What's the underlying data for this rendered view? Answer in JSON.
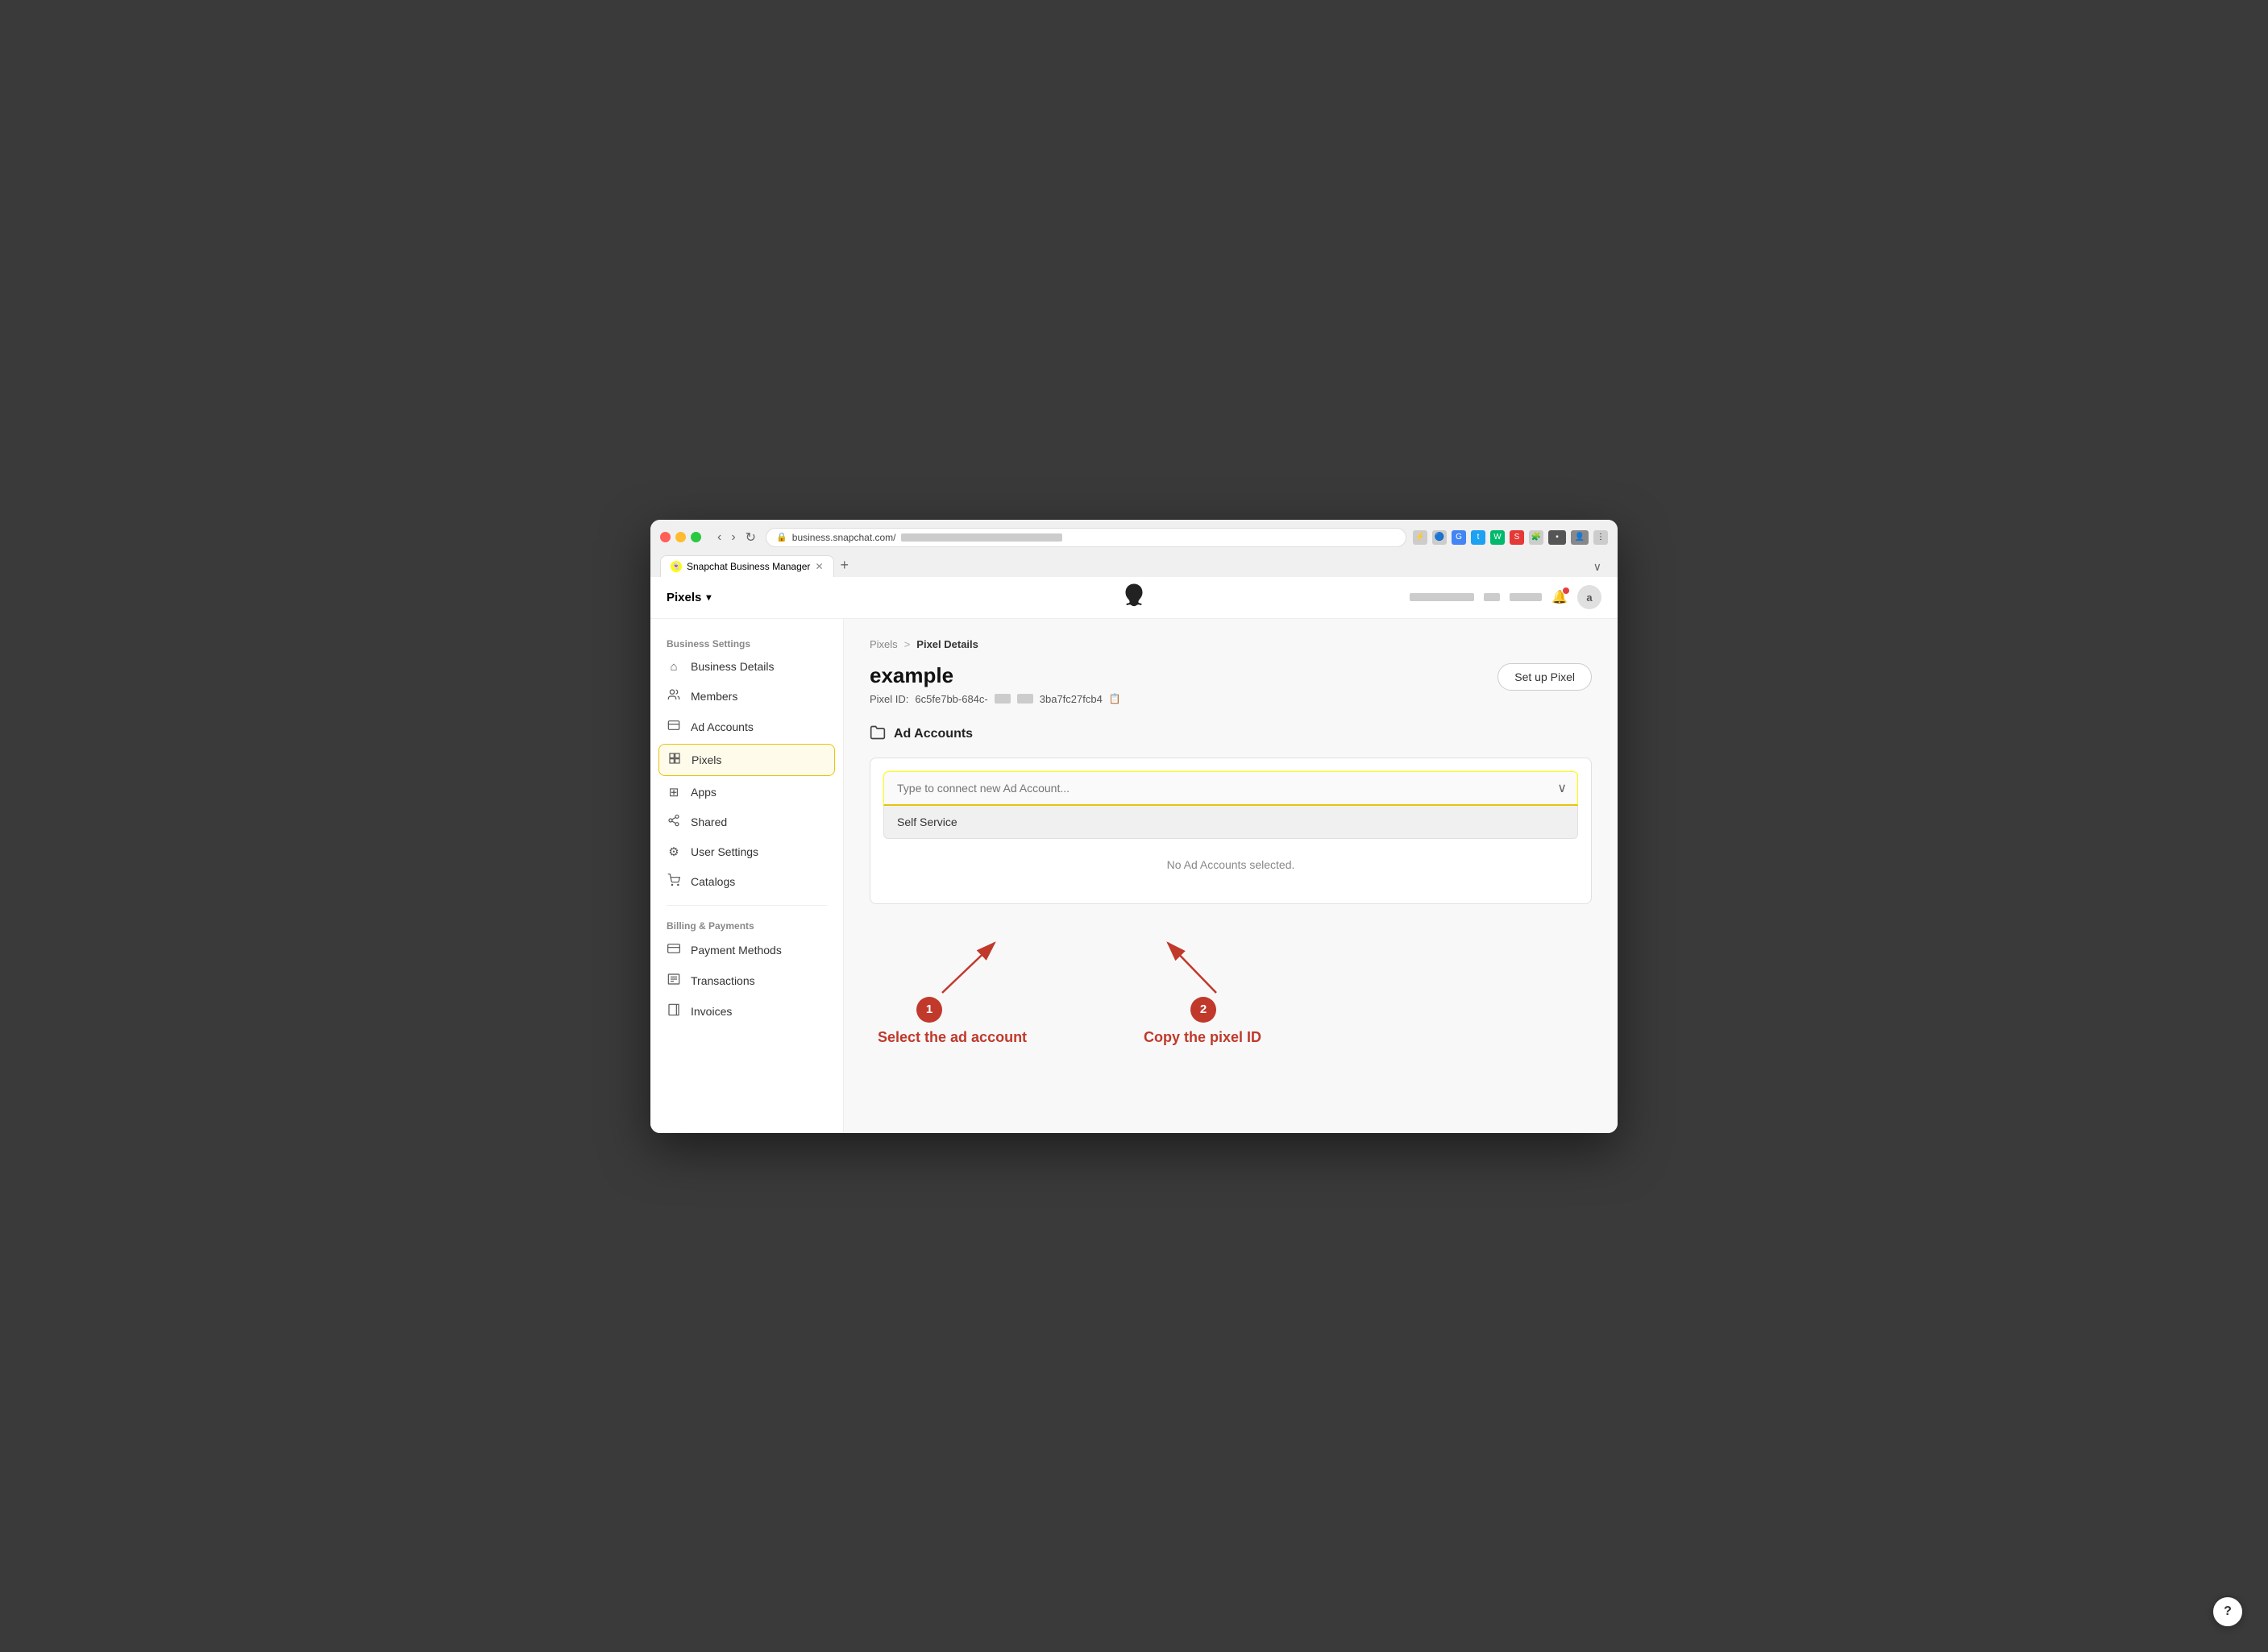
{
  "browser": {
    "tab_title": "Snapchat Business Manager",
    "url": "business.snapchat.com/",
    "new_tab_label": "+"
  },
  "topbar": {
    "pixels_label": "Pixels",
    "snapchat_logo": "👻",
    "notification_icon": "🔔",
    "avatar_label": "a"
  },
  "sidebar": {
    "business_settings_label": "Business Settings",
    "billing_payments_label": "Billing & Payments",
    "items": [
      {
        "id": "business-details",
        "label": "Business Details",
        "icon": "⌂"
      },
      {
        "id": "members",
        "label": "Members",
        "icon": "⚘"
      },
      {
        "id": "ad-accounts",
        "label": "Ad Accounts",
        "icon": "⬚"
      },
      {
        "id": "pixels",
        "label": "Pixels",
        "icon": "◇",
        "active": true
      },
      {
        "id": "apps",
        "label": "Apps",
        "icon": "⊞"
      },
      {
        "id": "shared",
        "label": "Shared",
        "icon": "⟨⟩"
      },
      {
        "id": "user-settings",
        "label": "User Settings",
        "icon": "⚙"
      },
      {
        "id": "catalogs",
        "label": "Catalogs",
        "icon": "🛒"
      },
      {
        "id": "payment-methods",
        "label": "Payment Methods",
        "icon": "▬"
      },
      {
        "id": "transactions",
        "label": "Transactions",
        "icon": "▤"
      },
      {
        "id": "invoices",
        "label": "Invoices",
        "icon": "▣"
      }
    ]
  },
  "breadcrumb": {
    "parent": "Pixels",
    "separator": ">",
    "current": "Pixel Details"
  },
  "page": {
    "title": "example",
    "pixel_id_label": "Pixel ID:",
    "pixel_id_value": "6c5fe7bb-684c-",
    "pixel_id_suffix": "3ba7fc27fcb4",
    "setup_pixel_btn": "Set up Pixel"
  },
  "ad_accounts_section": {
    "title": "Ad Accounts",
    "connect_placeholder": "Type to connect new Ad Account...",
    "dropdown_option": "Self Service",
    "no_accounts_msg": "No Ad Accounts selected."
  },
  "annotations": {
    "step1_number": "1",
    "step1_label": "Select the ad account",
    "step2_number": "2",
    "step2_label": "Copy the pixel ID"
  }
}
